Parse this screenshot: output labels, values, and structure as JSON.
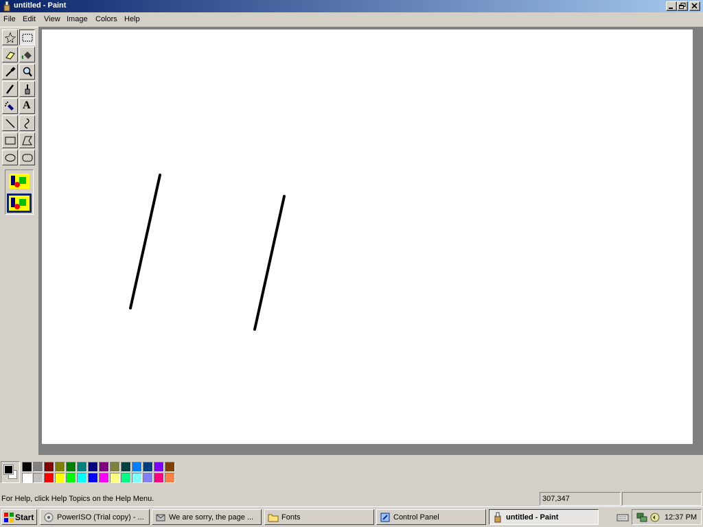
{
  "window": {
    "title": "untitled - Paint"
  },
  "menu": [
    "File",
    "Edit",
    "View",
    "Image",
    "Colors",
    "Help"
  ],
  "tools": [
    {
      "name": "free-form-select-tool",
      "icon": "star-select-icon"
    },
    {
      "name": "rect-select-tool",
      "icon": "dashed-rect-icon"
    },
    {
      "name": "eraser-tool",
      "icon": "eraser-icon"
    },
    {
      "name": "fill-tool",
      "icon": "paint-bucket-icon"
    },
    {
      "name": "pick-color-tool",
      "icon": "eyedropper-icon"
    },
    {
      "name": "magnifier-tool",
      "icon": "magnifier-icon"
    },
    {
      "name": "pencil-tool",
      "icon": "pencil-icon"
    },
    {
      "name": "brush-tool",
      "icon": "brush-icon"
    },
    {
      "name": "airbrush-tool",
      "icon": "airbrush-icon"
    },
    {
      "name": "text-tool",
      "icon": "text-a-icon",
      "glyph": "A"
    },
    {
      "name": "line-tool",
      "icon": "line-icon"
    },
    {
      "name": "curve-tool",
      "icon": "curve-icon"
    },
    {
      "name": "rectangle-tool",
      "icon": "rectangle-icon"
    },
    {
      "name": "polygon-tool",
      "icon": "polygon-icon"
    },
    {
      "name": "ellipse-tool",
      "icon": "ellipse-icon"
    },
    {
      "name": "rounded-rect-tool",
      "icon": "rounded-rect-icon"
    }
  ],
  "palette": {
    "foreground": "#000000",
    "background": "#ffffff",
    "row1": [
      "#000000",
      "#808080",
      "#800000",
      "#808000",
      "#008000",
      "#008080",
      "#000080",
      "#800080",
      "#808040",
      "#004040",
      "#0080ff",
      "#004080",
      "#8000ff",
      "#804000"
    ],
    "row2": [
      "#ffffff",
      "#c0c0c0",
      "#ff0000",
      "#ffff00",
      "#00ff00",
      "#00ffff",
      "#0000ff",
      "#ff00ff",
      "#ffff80",
      "#00ff80",
      "#80ffff",
      "#8080ff",
      "#ff0080",
      "#ff8040"
    ]
  },
  "status": {
    "help": "For Help, click Help Topics on the Help Menu.",
    "coords": "307,347"
  },
  "taskbar": {
    "start": "Start",
    "tasks": [
      {
        "label": "PowerISO (Trial copy) - ...",
        "icon": "poweriso-icon"
      },
      {
        "label": "We are sorry, the page ...",
        "icon": "browser-icon"
      },
      {
        "label": "Fonts",
        "icon": "folder-icon"
      },
      {
        "label": "Control Panel",
        "icon": "control-panel-icon"
      },
      {
        "label": "untitled - Paint",
        "icon": "paint-icon",
        "active": true
      }
    ],
    "clock": "12:37 PM"
  }
}
